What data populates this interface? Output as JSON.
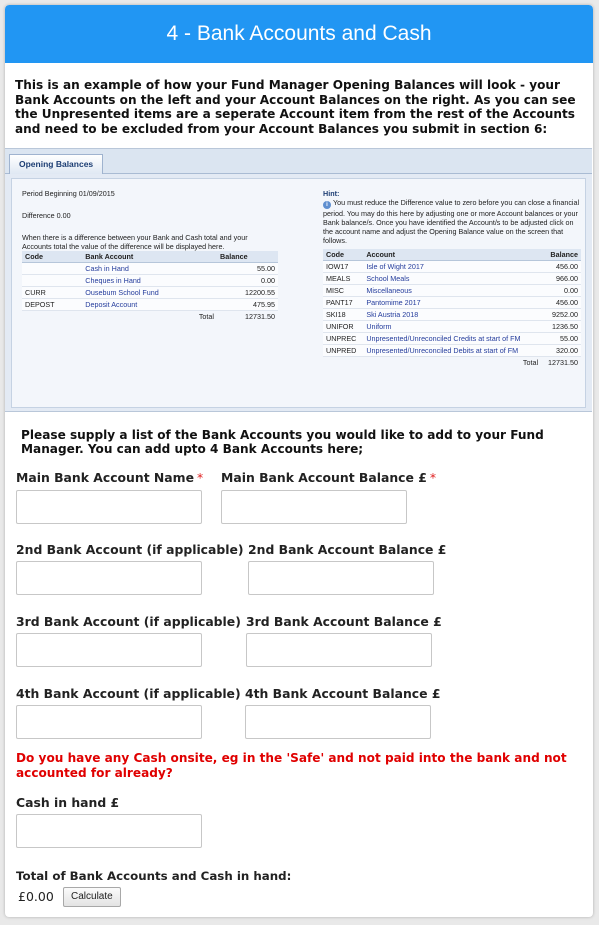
{
  "header": {
    "title": "4 - Bank Accounts and Cash"
  },
  "intro": "This is an example of how your Fund Manager Opening Balances will look - your Bank Accounts on the left and your Account Balances on the right.  As you can see the Unpresented items are a seperate Account item from the rest of the Accounts and need to be excluded from your Account Balances you submit in section 6:",
  "example": {
    "tab": "Opening Balances",
    "period": "Period Beginning 01/09/2015",
    "difference": "Difference 0.00",
    "note": "When there is a difference between your Bank and Cash total and your Accounts total the value of the difference will be displayed here.",
    "left_headers": [
      "Code",
      "Bank Account",
      "Balance"
    ],
    "left_rows": [
      [
        "",
        "Cash in Hand",
        "55.00"
      ],
      [
        "",
        "Cheques in Hand",
        "0.00"
      ],
      [
        "CURR",
        "Ousebum School Fund",
        "12200.55"
      ],
      [
        "DEPOST",
        "Deposit Account",
        "475.95"
      ]
    ],
    "left_total_label": "Total",
    "left_total": "12731.50",
    "hint_title": "Hint:",
    "hint": "You must reduce the Difference value to zero before you can close a financial period. You may do this here by adjusting one or more Account balances or your Bank balance/s. Once you have identified the Account/s to be adjusted click on the account name and adjust the Opening Balance value on the screen that follows.",
    "right_headers": [
      "Code",
      "Account",
      "Balance"
    ],
    "right_rows": [
      [
        "IOW17",
        "Isle of Wight 2017",
        "456.00"
      ],
      [
        "MEALS",
        "School Meals",
        "966.00"
      ],
      [
        "MISC",
        "Miscellaneous",
        "0.00"
      ],
      [
        "PANT17",
        "Pantomime 2017",
        "456.00"
      ],
      [
        "SKI18",
        "Ski Austria 2018",
        "9252.00"
      ],
      [
        "UNIFOR",
        "Uniform",
        "1236.50"
      ],
      [
        "UNPREC",
        "Unpresented/Unreconciled Credits at start of FM",
        "55.00"
      ],
      [
        "UNPRED",
        "Unpresented/Unreconciled Debits at start of FM",
        "320.00"
      ]
    ],
    "right_total_label": "Total",
    "right_total": "12731.50"
  },
  "form": {
    "prompt": "Please supply a list of the Bank Accounts you would like to add to your Fund Manager. You can add upto 4 Bank Accounts here;",
    "main_name_label": "Main Bank Account Name",
    "main_balance_label": "Main Bank Account Balance £",
    "required_mark": "*",
    "acc2_label": "2nd Bank Account (if applicable)",
    "acc2_balance_label": "2nd Bank Account Balance £",
    "acc3_label": "3rd Bank Account (if applicable)",
    "acc3_balance_label": "3rd Bank Account Balance £",
    "acc4_label": "4th Bank Account (if applicable)",
    "acc4_balance_label": "4th Bank Account Balance £",
    "cash_question": "Do you have any Cash onsite, eg in the 'Safe' and not paid into the bank and not accounted for already?",
    "cash_label": "Cash in hand £",
    "total_label": "Total of Bank Accounts and Cash in hand:",
    "total_value": "£0.00",
    "calculate_label": "Calculate"
  },
  "colors": {
    "header": "#2196f3",
    "required": "#e02020",
    "question": "#e00000"
  }
}
